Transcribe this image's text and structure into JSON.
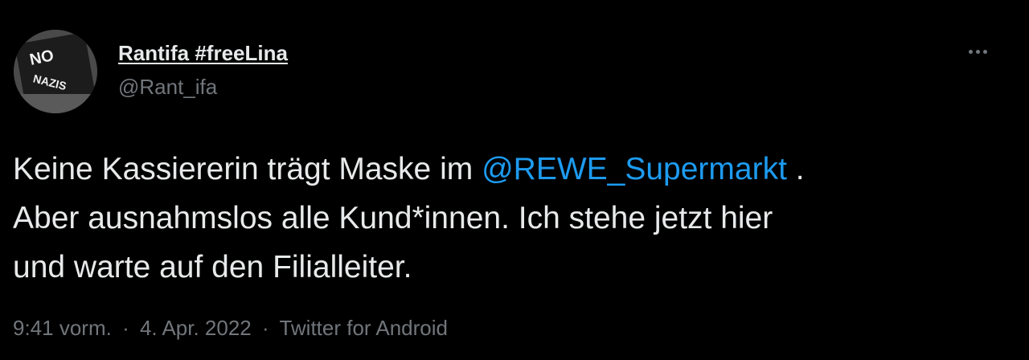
{
  "author": {
    "display_name": "Rantifa #freeLina",
    "handle": "@Rant_ifa",
    "avatar_text": [
      "NO",
      "NAZIS"
    ]
  },
  "tweet": {
    "line1_before": "Keine Kassiererin trägt Maske im ",
    "mention": "@REWE_Supermarkt",
    "line1_after": " .",
    "line2": "Aber ausnahmslos alle Kund*innen. Ich stehe jetzt hier",
    "line3": "und warte auf den Filialleiter."
  },
  "meta": {
    "time": "9:41 vorm.",
    "separator": "·",
    "date": "4. Apr. 2022",
    "source": "Twitter for Android"
  },
  "colors": {
    "background": "#000000",
    "text": "#e7e9ea",
    "secondary": "#71767b",
    "link": "#1d9bf0"
  },
  "icons": {
    "more": "more-horizontal-icon"
  }
}
